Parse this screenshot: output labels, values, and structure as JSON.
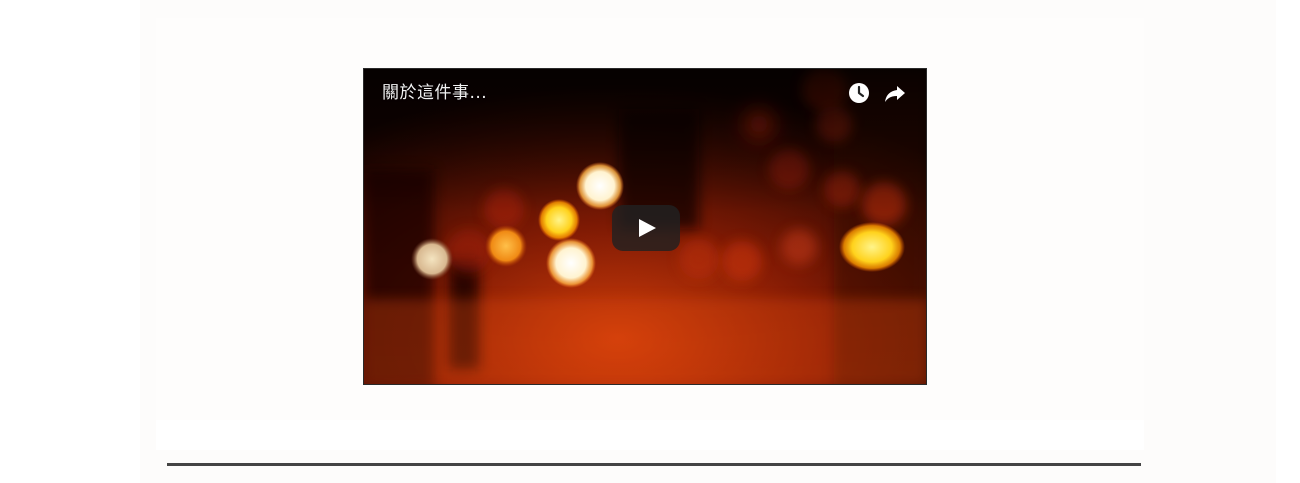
{
  "video": {
    "title": "關於這件事...",
    "overlay_icons": [
      "clock-icon",
      "share-arrow-icon"
    ],
    "center_control": "play-icon"
  },
  "colors": {
    "play_button_bg": "#212121",
    "title_text": "#f2f2f2",
    "divider": "#444444",
    "card_bg": "#fefdfc"
  }
}
